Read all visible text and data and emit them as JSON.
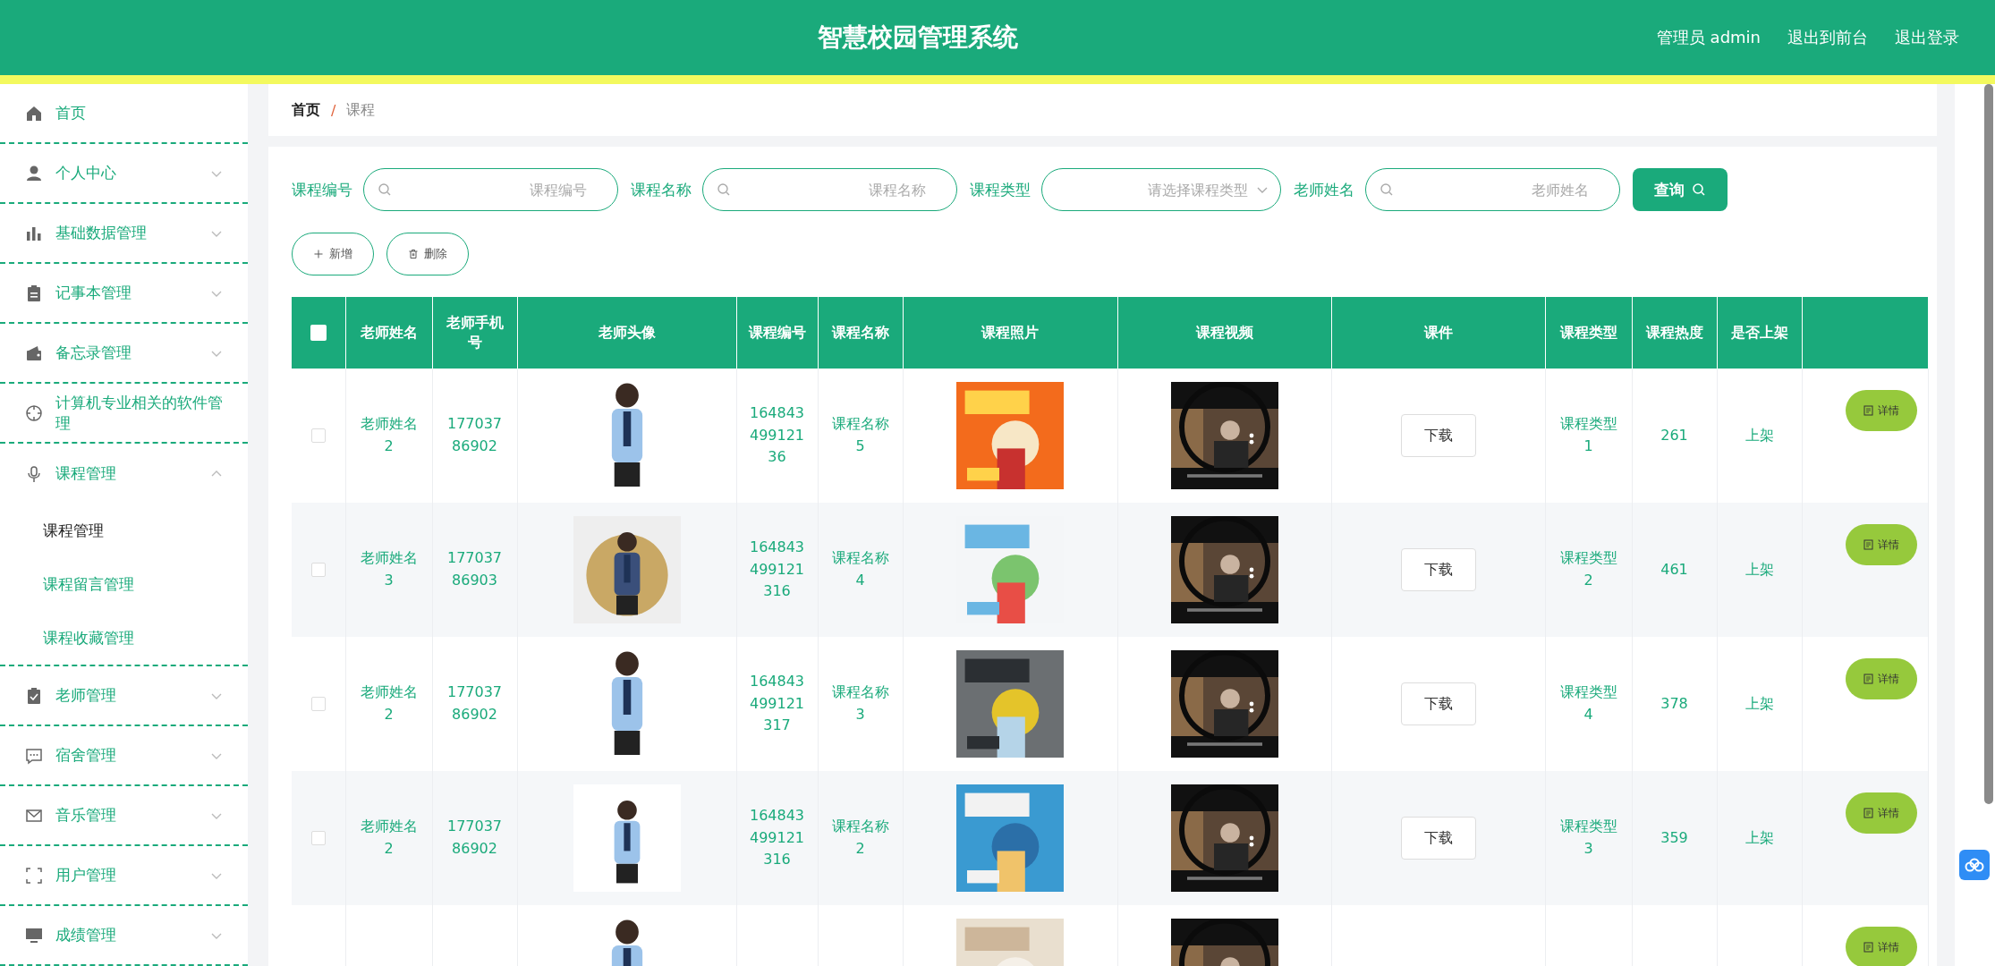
{
  "header": {
    "title": "智慧校园管理系统",
    "links": [
      "管理员 admin",
      "退出到前台",
      "退出登录"
    ]
  },
  "sidebar": {
    "items": [
      {
        "label": "首页",
        "kind": "link"
      },
      {
        "label": "个人中心",
        "kind": "menu",
        "expanded": false
      },
      {
        "label": "基础数据管理",
        "kind": "menu",
        "expanded": false
      },
      {
        "label": "记事本管理",
        "kind": "menu",
        "expanded": false
      },
      {
        "label": "备忘录管理",
        "kind": "menu",
        "expanded": false
      },
      {
        "label": "计算机专业相关的软件管理",
        "kind": "link"
      },
      {
        "label": "课程管理",
        "kind": "menu",
        "expanded": true,
        "children": [
          {
            "label": "课程管理",
            "selected": true
          },
          {
            "label": "课程留言管理",
            "selected": false
          },
          {
            "label": "课程收藏管理",
            "selected": false
          }
        ]
      },
      {
        "label": "老师管理",
        "kind": "menu",
        "expanded": false
      },
      {
        "label": "宿舍管理",
        "kind": "menu",
        "expanded": false
      },
      {
        "label": "音乐管理",
        "kind": "menu",
        "expanded": false
      },
      {
        "label": "用户管理",
        "kind": "menu",
        "expanded": false
      },
      {
        "label": "成绩管理",
        "kind": "menu",
        "expanded": false
      }
    ]
  },
  "breadcrumb": [
    "首页",
    "课程"
  ],
  "breadcrumb_separator": "/",
  "filters": [
    {
      "label": "课程编号",
      "kind": "search",
      "placeholder": "课程编号"
    },
    {
      "label": "课程名称",
      "kind": "search",
      "placeholder": "课程名称"
    },
    {
      "label": "课程类型",
      "kind": "select",
      "placeholder": "请选择课程类型"
    },
    {
      "label": "老师姓名",
      "kind": "search",
      "placeholder": "老师姓名"
    }
  ],
  "query_button": "查询",
  "actions": [
    {
      "label": "新增",
      "kind": "add"
    },
    {
      "label": "删除",
      "kind": "delete"
    }
  ],
  "table": {
    "select_all": {
      "checked": false
    },
    "columns": [
      "老师姓名",
      "老师手机号",
      "老师头像",
      "课程编号",
      "课程名称",
      "课程照片",
      "课程视频",
      "课件",
      "课程类型",
      "课程热度",
      "是否上架"
    ],
    "rows": [
      {
        "checked": false,
        "teacher": "老师姓名2",
        "phone": "17703786902",
        "course_no": "16484349912136",
        "course_name": "课程名称5",
        "file": "下载",
        "type": "课程类型1",
        "heat": "261",
        "listed": "上架",
        "detail": "详情"
      },
      {
        "checked": false,
        "teacher": "老师姓名3",
        "phone": "17703786903",
        "course_no": "164843499121316",
        "course_name": "课程名称4",
        "file": "下载",
        "type": "课程类型2",
        "heat": "461",
        "listed": "上架",
        "detail": "详情"
      },
      {
        "checked": false,
        "teacher": "老师姓名2",
        "phone": "17703786902",
        "course_no": "164843499121317",
        "course_name": "课程名称3",
        "file": "下载",
        "type": "课程类型4",
        "heat": "378",
        "listed": "上架",
        "detail": "详情"
      },
      {
        "checked": false,
        "teacher": "老师姓名2",
        "phone": "17703786902",
        "course_no": "164843499121316",
        "course_name": "课程名称2",
        "file": "下载",
        "type": "课程类型3",
        "heat": "359",
        "listed": "上架",
        "detail": "详情"
      },
      {
        "detail": "详情"
      }
    ]
  }
}
